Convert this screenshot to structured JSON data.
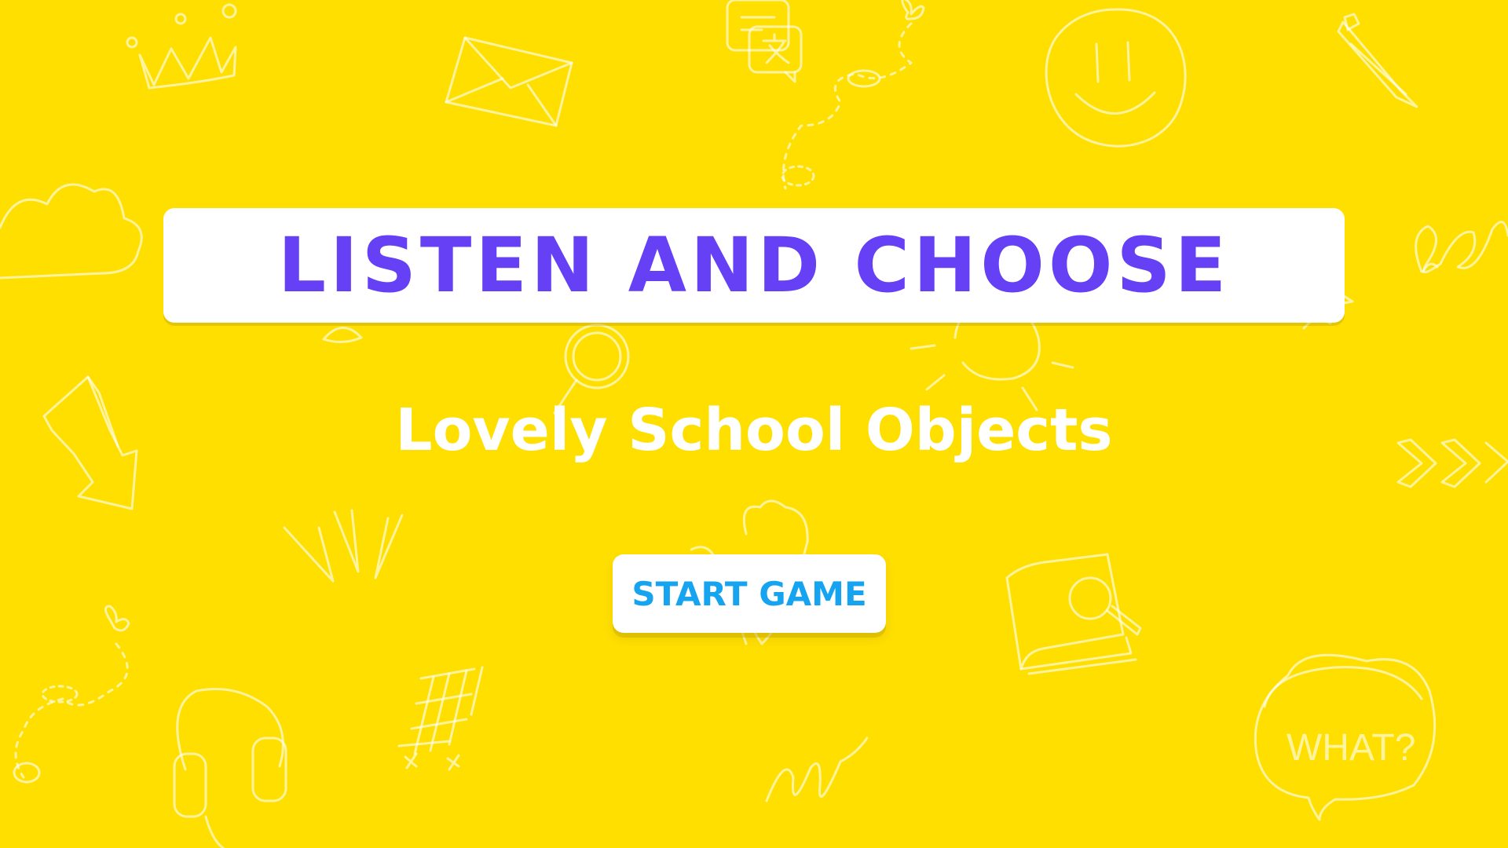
{
  "title": "LISTEN AND CHOOSE",
  "subtitle": "Lovely School Objects",
  "start_button": {
    "label": "START GAME"
  },
  "decor": {
    "speech_bubble_text": "WHAT?"
  },
  "colors": {
    "background": "#FFDF00",
    "title_text": "#6540F5",
    "button_text": "#16A4F0",
    "panel": "#FFFFFF"
  },
  "icons": [
    "crown-icon",
    "envelope-icon",
    "translate-bubble-icon",
    "butterfly-icon",
    "smiley-face-icon",
    "pencil-icon",
    "cloud-icon",
    "spiral-icon",
    "arrow-icon",
    "magnifier-icon",
    "sun-icon",
    "chevrons-icon",
    "sparkle-lines-icon",
    "heart-icon",
    "book-search-icon",
    "headphones-icon",
    "hash-scribble-icon",
    "squiggle-icon",
    "speech-bubble-icon",
    "star-icon"
  ]
}
